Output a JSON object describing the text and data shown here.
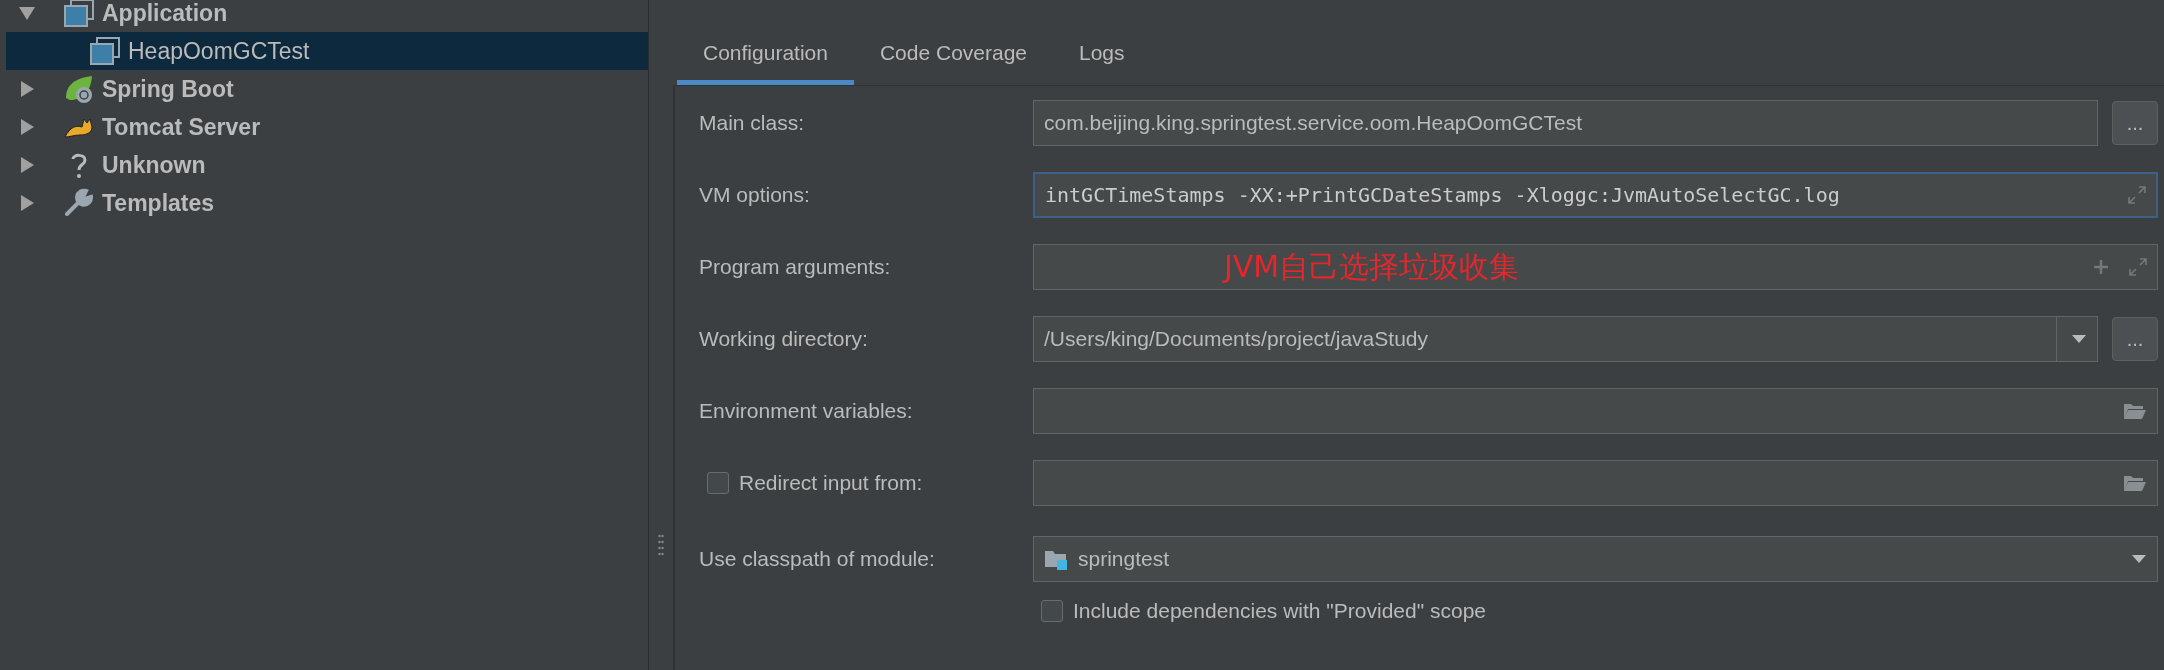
{
  "tree": [
    {
      "label": "Application",
      "kind": "app",
      "expanded": true,
      "selected": false,
      "children": [
        {
          "label": "HeapOomGCTest",
          "kind": "app",
          "selected": true
        }
      ]
    },
    {
      "label": "Spring Boot",
      "kind": "spring",
      "expanded": false,
      "selected": false
    },
    {
      "label": "Tomcat Server",
      "kind": "tomcat",
      "expanded": false,
      "selected": false
    },
    {
      "label": "Unknown",
      "kind": "unknown",
      "expanded": false,
      "selected": false
    },
    {
      "label": "Templates",
      "kind": "templates",
      "expanded": false,
      "selected": false
    }
  ],
  "tabs": [
    {
      "label": "Configuration",
      "selected": true
    },
    {
      "label": "Code Coverage",
      "selected": false
    },
    {
      "label": "Logs",
      "selected": false
    }
  ],
  "form": [
    {
      "kind": "browse",
      "label": "Main class:",
      "value": "com.beijing.king.springtest.service.oom.HeapOomGCTest",
      "focused": false,
      "button": "..."
    },
    {
      "kind": "expand",
      "label": "VM options:",
      "value": "intGCTimeStamps -XX:+PrintGCDateStamps -Xloggc:JvmAutoSelectGC.log",
      "focused": true
    },
    {
      "kind": "args",
      "label": "Program arguments:",
      "focused": false,
      "annotation": "JVM自己选择垃圾收集"
    },
    {
      "kind": "combo",
      "label": "Working directory:",
      "value": "/Users/king/Documents/project/javaStudy",
      "focused": false,
      "button": "..."
    },
    {
      "kind": "folder",
      "label": "Environment variables:",
      "focused": false
    },
    {
      "kind": "folder",
      "label": "Redirect input from:",
      "focused": false,
      "checked": false
    },
    {
      "kind": "module",
      "label": "Use classpath of module:",
      "value": "springtest",
      "focused": false
    },
    {
      "kind": "check",
      "label": "Include dependencies with \"Provided\" scope",
      "checked": false
    }
  ]
}
